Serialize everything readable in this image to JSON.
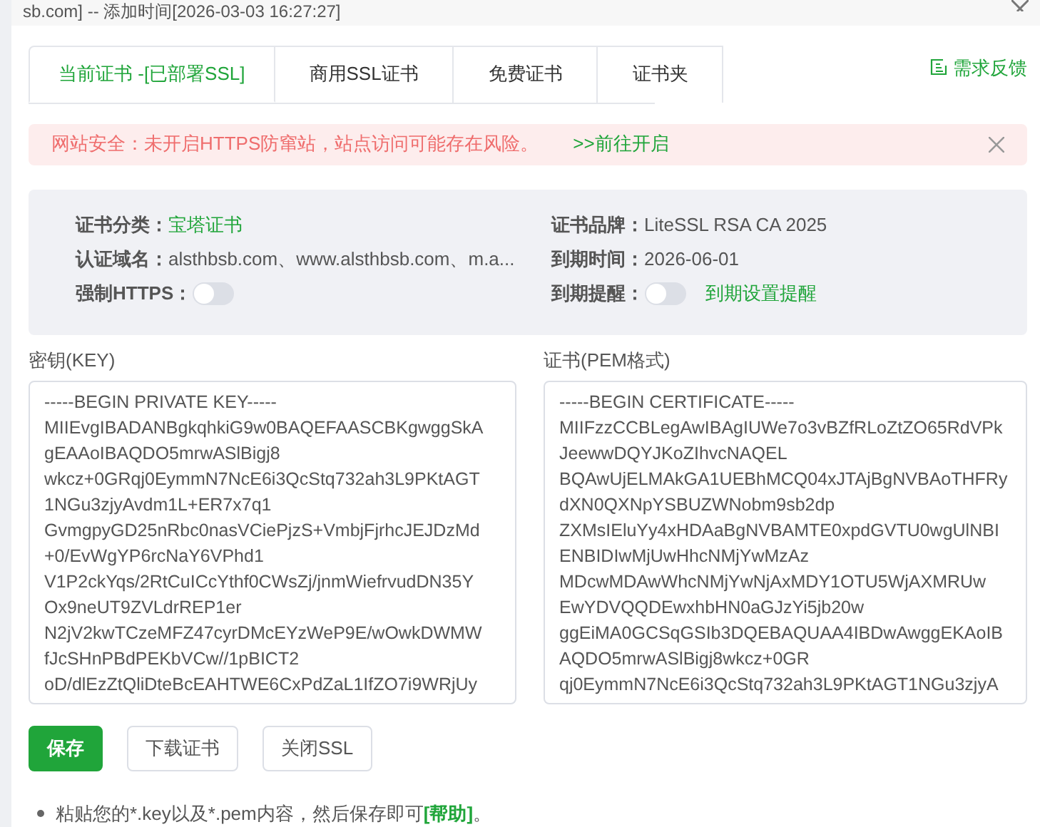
{
  "window": {
    "title": "sb.com]  --  添加时间[2026-03-03 16:27:27]"
  },
  "tabs": [
    {
      "label": "当前证书 -[已部署SSL]",
      "selected": true
    },
    {
      "label": "商用SSL证书",
      "selected": false
    },
    {
      "label": "免费证书",
      "selected": false
    },
    {
      "label": "证书夹",
      "selected": false
    }
  ],
  "feedback_link": "需求反馈",
  "alert": {
    "message": "网站安全：未开启HTTPS防窜站，站点访问可能存在风险。",
    "link": ">>前往开启"
  },
  "info": {
    "category": {
      "label": "证书分类：",
      "value": "宝塔证书"
    },
    "brand": {
      "label": "证书品牌：",
      "value": "LiteSSL RSA CA 2025"
    },
    "domains": {
      "label": "认证域名：",
      "value": "alsthbsb.com、www.alsthbsb.com、m.a..."
    },
    "expiry": {
      "label": "到期时间：",
      "value": "2026-06-01"
    },
    "force_https": {
      "label": "强制HTTPS：",
      "on": false
    },
    "expiry_reminder": {
      "label": "到期提醒：",
      "on": false,
      "link": "到期设置提醒"
    }
  },
  "key": {
    "label": "密钥(KEY)",
    "value": "-----BEGIN PRIVATE KEY-----\nMIIEvgIBADANBgkqhkiG9w0BAQEFAASCBKgwggSkA\ngEAAoIBAQDO5mrwASlBigj8\nwkcz+0GRqj0EymmN7NcE6i3QcStq732ah3L9PKtAGT\n1NGu3zjyAvdm1L+ER7x7q1\nGvmgpyGD25nRbc0nasVCiePjzS+VmbjFjrhcJEJDzMd\n+0/EvWgYP6rcNaY6VPhd1\nV1P2ckYqs/2RtCuICcYthf0CWsZj/jnmWiefrvudDN35Y\nOx9neUT9ZVLdrREP1er\nN2jV2kwTCzeMFZ47cyrDMcEYzWeP9E/wOwkDWMW\nfJcSHnPBdPEKbVCw//1pBICT2\noD/dlEzZtQliDteBcEAHTWE6CxPdZaL1IfZO7i9WRjUy"
  },
  "certificate": {
    "label": "证书(PEM格式)",
    "value": "-----BEGIN CERTIFICATE-----\nMIIFzzCCBLegAwIBAgIUWe7o3vBZfRLoZtZO65RdVPk\nJeewwDQYJKoZIhvcNAQEL\nBQAwUjELMAkGA1UEBhMCQ04xJTAjBgNVBAoTHFRy\ndXN0QXNpYSBUZWNobm9sb2dp\nZXMsIEluYy4xHDAaBgNVBAMTE0xpdGVTU0wgUlNBI\nENBIDIwMjUwHhcNMjYwMzAz\nMDcwMDAwWhcNMjYwNjAxMDY1OTU5WjAXMRUw\nEwYDVQQDEwxhbHN0aGJzYi5jb20w\nggEiMA0GCSqGSIb3DQEBAQUAA4IBDwAwggEKAoIB\nAQDO5mrwASlBigj8wkcz+0GR\nqj0EymmN7NcE6i3QcStq732ah3L9PKtAGT1NGu3zjyA"
  },
  "buttons": [
    {
      "label": "保存",
      "kind": "primary"
    },
    {
      "label": "下载证书",
      "kind": "default"
    },
    {
      "label": "关闭SSL",
      "kind": "default"
    }
  ],
  "tip": "粘贴您的*.key以及*.pem内容，然后保存即可**[帮助]**。"
}
